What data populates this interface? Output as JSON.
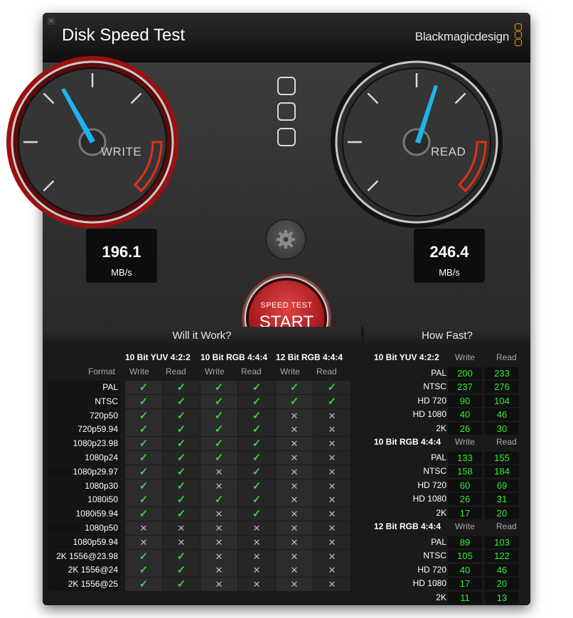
{
  "app": {
    "title": "Disk Speed Test",
    "brand": "Blackmagicdesign",
    "close": "×"
  },
  "colors": {
    "accent_orange": "#f29400",
    "needle": "#1fb3f0",
    "ok_green": "#39d33b",
    "value_green": "#2df12d",
    "start_red": "#b52023"
  },
  "gauges": {
    "write": {
      "label": "WRITE",
      "value": "196.1",
      "unit": "MB/s"
    },
    "read": {
      "label": "READ",
      "value": "246.4",
      "unit": "MB/s"
    }
  },
  "start_button": {
    "small": "SPEED TEST",
    "big": "START"
  },
  "will_it_work": {
    "title": "Will it Work?",
    "format_label": "Format",
    "groups": [
      "10 Bit YUV 4:2:2",
      "10 Bit RGB 4:4:4",
      "12 Bit RGB 4:4:4"
    ],
    "write_label": "Write",
    "read_label": "Read",
    "rows": [
      {
        "format": "PAL",
        "r": [
          1,
          1,
          1,
          1,
          1,
          1
        ]
      },
      {
        "format": "NTSC",
        "r": [
          1,
          1,
          1,
          1,
          1,
          1
        ]
      },
      {
        "format": "720p50",
        "r": [
          1,
          1,
          1,
          1,
          0,
          0
        ]
      },
      {
        "format": "720p59.94",
        "r": [
          1,
          1,
          1,
          1,
          0,
          0
        ]
      },
      {
        "format": "1080p23.98",
        "r": [
          1,
          1,
          1,
          1,
          0,
          0
        ]
      },
      {
        "format": "1080p24",
        "r": [
          1,
          1,
          1,
          1,
          0,
          0
        ]
      },
      {
        "format": "1080p29.97",
        "r": [
          1,
          1,
          0,
          1,
          0,
          0
        ]
      },
      {
        "format": "1080p30",
        "r": [
          1,
          1,
          0,
          1,
          0,
          0
        ]
      },
      {
        "format": "1080i50",
        "r": [
          1,
          1,
          1,
          1,
          0,
          0
        ]
      },
      {
        "format": "1080i59.94",
        "r": [
          1,
          1,
          0,
          1,
          0,
          0
        ]
      },
      {
        "format": "1080p50",
        "r": [
          0,
          0,
          0,
          0,
          0,
          0
        ]
      },
      {
        "format": "1080p59.94",
        "r": [
          0,
          0,
          0,
          0,
          0,
          0
        ]
      },
      {
        "format": "2K 1556@23.98",
        "r": [
          1,
          1,
          0,
          0,
          0,
          0
        ]
      },
      {
        "format": "2K 1556@24",
        "r": [
          1,
          1,
          0,
          0,
          0,
          0
        ]
      },
      {
        "format": "2K 1556@25",
        "r": [
          1,
          1,
          0,
          0,
          0,
          0
        ]
      }
    ]
  },
  "how_fast": {
    "title": "How Fast?",
    "write_label": "Write",
    "read_label": "Read",
    "groups": [
      {
        "name": "10 Bit YUV 4:2:2",
        "rows": [
          {
            "format": "PAL",
            "write": "200",
            "read": "233"
          },
          {
            "format": "NTSC",
            "write": "237",
            "read": "276"
          },
          {
            "format": "HD 720",
            "write": "90",
            "read": "104"
          },
          {
            "format": "HD 1080",
            "write": "40",
            "read": "46"
          },
          {
            "format": "2K",
            "write": "26",
            "read": "30"
          }
        ]
      },
      {
        "name": "10 Bit RGB 4:4:4",
        "rows": [
          {
            "format": "PAL",
            "write": "133",
            "read": "155"
          },
          {
            "format": "NTSC",
            "write": "158",
            "read": "184"
          },
          {
            "format": "HD 720",
            "write": "60",
            "read": "69"
          },
          {
            "format": "HD 1080",
            "write": "26",
            "read": "31"
          },
          {
            "format": "2K",
            "write": "17",
            "read": "20"
          }
        ]
      },
      {
        "name": "12 Bit RGB 4:4:4",
        "rows": [
          {
            "format": "PAL",
            "write": "89",
            "read": "103"
          },
          {
            "format": "NTSC",
            "write": "105",
            "read": "122"
          },
          {
            "format": "HD 720",
            "write": "40",
            "read": "46"
          },
          {
            "format": "HD 1080",
            "write": "17",
            "read": "20"
          },
          {
            "format": "2K",
            "write": "11",
            "read": "13"
          }
        ]
      }
    ]
  },
  "icons": {
    "ok": "✓",
    "no": "✕"
  }
}
